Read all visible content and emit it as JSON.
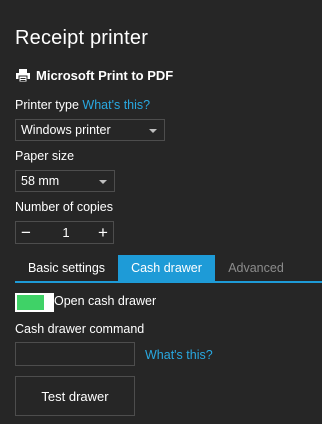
{
  "header": {
    "title": "Receipt printer"
  },
  "printer": {
    "icon": "printer-icon",
    "name": "Microsoft Print to PDF"
  },
  "printer_type": {
    "label": "Printer type",
    "help_link": "What's this?",
    "selected": "Windows printer"
  },
  "paper_size": {
    "label": "Paper size",
    "selected": "58 mm"
  },
  "copies": {
    "label": "Number of copies",
    "value": "1",
    "decrement": "−",
    "increment": "+"
  },
  "tabs": [
    {
      "label": "Basic settings",
      "state": "inactive"
    },
    {
      "label": "Cash drawer",
      "state": "active"
    },
    {
      "label": "Advanced",
      "state": "disabled"
    }
  ],
  "cash_drawer": {
    "toggle_label": "Open cash drawer",
    "toggle_on": true,
    "command_label": "Cash drawer command",
    "command_value": "",
    "help_link": "What's this?",
    "test_button": "Test drawer"
  },
  "colors": {
    "background": "#262626",
    "accent": "#1e9bd7",
    "link": "#29a8e0",
    "toggle_on": "#3fd267"
  }
}
